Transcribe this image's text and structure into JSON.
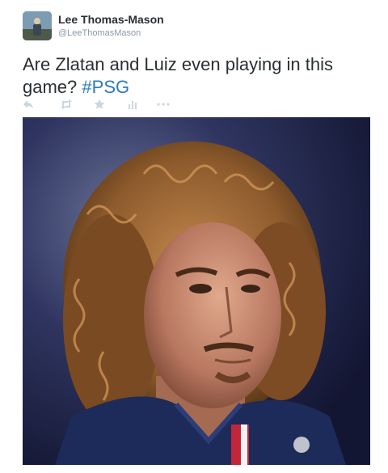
{
  "author": {
    "display_name": "Lee Thomas-Mason",
    "handle": "@LeeThomasMason",
    "avatar_icon": "profile-photo"
  },
  "tweet": {
    "text": "Are Zlatan and Luiz even playing in this game?",
    "hashtag": "#PSG"
  },
  "actions": [
    {
      "icon": "reply-icon"
    },
    {
      "icon": "retweet-icon"
    },
    {
      "icon": "favorite-star-icon"
    },
    {
      "icon": "analytics-bars-icon"
    },
    {
      "icon": "more-dots-icon"
    }
  ],
  "colors": {
    "text": "#292f33",
    "muted": "#8899a6",
    "link": "#2b7bb9",
    "action_icons": "#ccd6dd"
  }
}
